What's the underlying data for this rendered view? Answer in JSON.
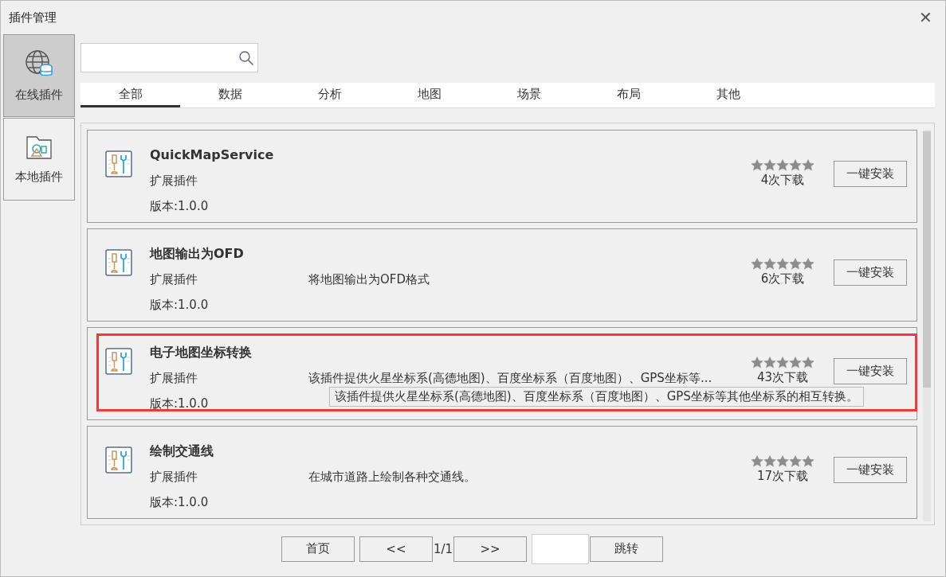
{
  "window": {
    "title": "插件管理",
    "close": "✕"
  },
  "sidebar": {
    "items": [
      {
        "label": "在线插件",
        "selected": true
      },
      {
        "label": "本地插件",
        "selected": false
      }
    ]
  },
  "tabs": [
    {
      "label": "全部",
      "selected": true
    },
    {
      "label": "数据",
      "selected": false
    },
    {
      "label": "分析",
      "selected": false
    },
    {
      "label": "地图",
      "selected": false
    },
    {
      "label": "场景",
      "selected": false
    },
    {
      "label": "布局",
      "selected": false
    },
    {
      "label": "其他",
      "selected": false
    }
  ],
  "plugins": [
    {
      "name": "QuickMapService",
      "type": "扩展插件",
      "version": "版本:1.0.0",
      "stars": 5,
      "downloads": "4次下载",
      "button": "一键安装",
      "highlighted": false
    },
    {
      "name": "地图输出为OFD",
      "type": "扩展插件",
      "version": "版本:1.0.0",
      "description": "将地图输出为OFD格式",
      "stars": 5,
      "downloads": "6次下载",
      "button": "一键安装",
      "highlighted": false
    },
    {
      "name": "电子地图坐标转换",
      "type": "扩展插件",
      "version": "版本:1.0.0",
      "description": "该插件提供火星坐标系(高德地图)、百度坐标系（百度地图）、GPS坐标等...",
      "tooltip": "该插件提供火星坐标系(高德地图)、百度坐标系（百度地图）、GPS坐标等其他坐标系的相互转换。",
      "stars": 5,
      "downloads": "43次下载",
      "button": "一键安装",
      "highlighted": true
    },
    {
      "name": "绘制交通线",
      "type": "扩展插件",
      "version": "版本:1.0.0",
      "description": "在城市道路上绘制各种交通线。",
      "stars": 5,
      "downloads": "17次下载",
      "button": "一键安装",
      "highlighted": false
    }
  ],
  "pagination": {
    "first": "首页",
    "prev": "<<",
    "page": "1/1",
    "next": ">>",
    "jump": "跳转"
  }
}
